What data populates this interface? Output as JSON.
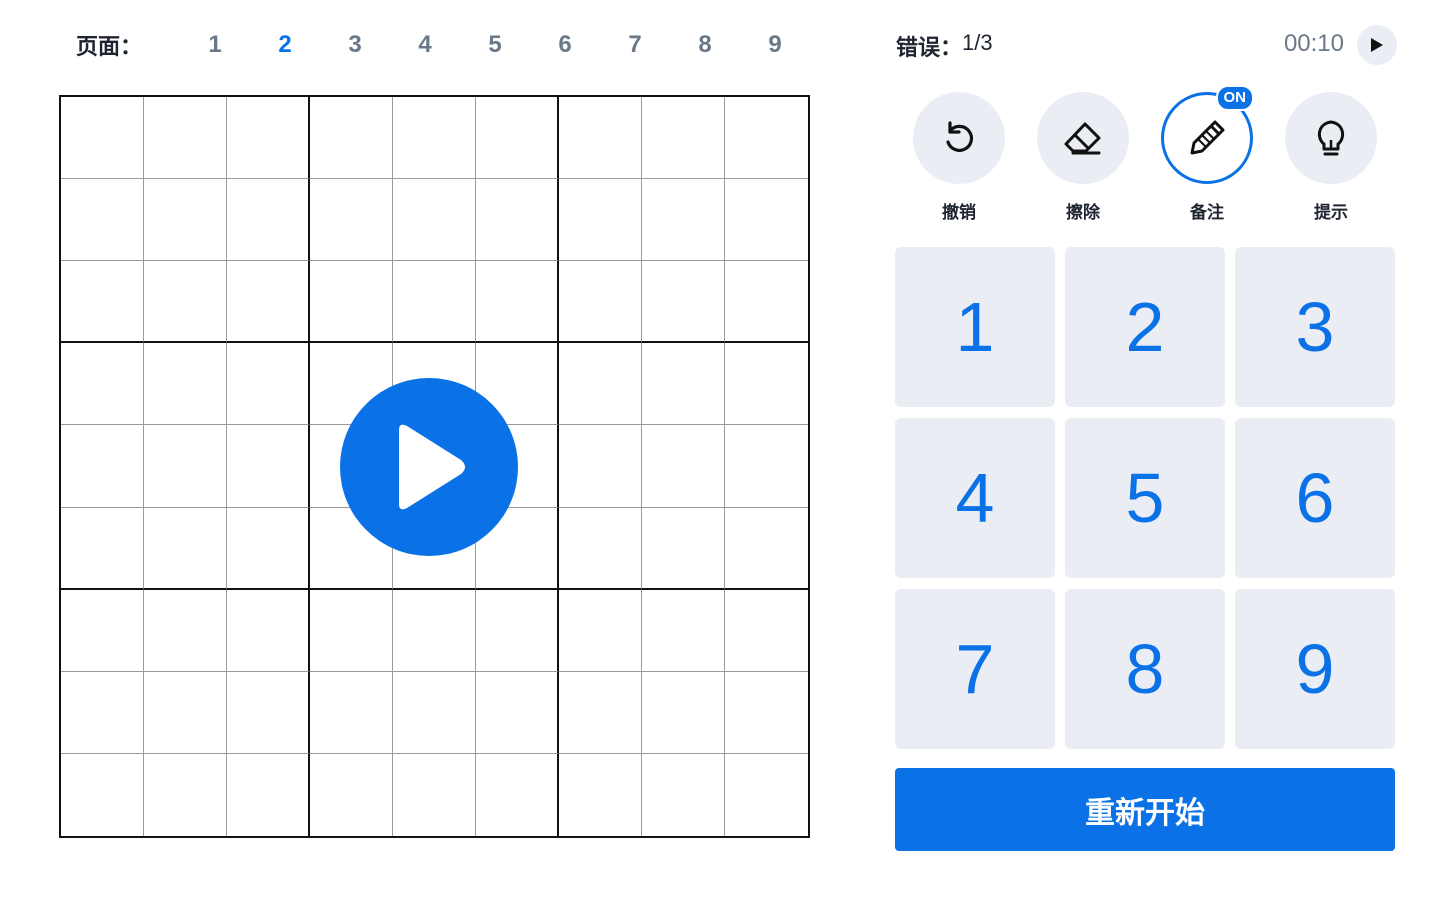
{
  "pages": {
    "label": "页面：",
    "numbers": [
      "1",
      "2",
      "3",
      "4",
      "5",
      "6",
      "7",
      "8",
      "9"
    ],
    "active": "2"
  },
  "status": {
    "mistakes_label": "错误：",
    "mistakes_value": "1/3",
    "timer": "00:10",
    "timer_icon": "play-icon"
  },
  "board": {
    "overlay_icon": "play-icon"
  },
  "tools": [
    {
      "id": "undo",
      "label": "撤销",
      "icon": "undo-icon"
    },
    {
      "id": "erase",
      "label": "擦除",
      "icon": "eraser-icon"
    },
    {
      "id": "notes",
      "label": "备注",
      "icon": "pencil-icon",
      "badge": "ON",
      "on": true
    },
    {
      "id": "hint",
      "label": "提示",
      "icon": "lightbulb-icon"
    }
  ],
  "numpad": [
    "1",
    "2",
    "3",
    "4",
    "5",
    "6",
    "7",
    "8",
    "9"
  ],
  "restart_label": "重新开始",
  "colors": {
    "accent": "#0a72e6",
    "key_bg": "#eaedf4",
    "text_dark": "#1e2430",
    "text_muted": "#6b7888"
  }
}
